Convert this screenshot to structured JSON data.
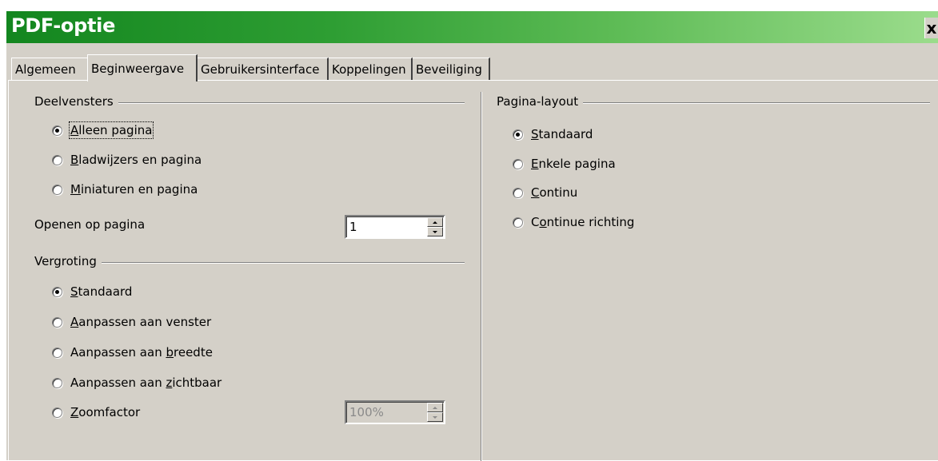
{
  "window": {
    "title": "PDF-optie",
    "close_glyph": "x"
  },
  "tabs": [
    "Algemeen",
    "Beginweergave",
    "Gebruikersinterface",
    "Koppelingen",
    "Beveiliging"
  ],
  "active_tab": "Beginweergave",
  "deelvensters": {
    "label": "Deelvensters",
    "options": [
      {
        "pre": "",
        "u": "A",
        "post": "lleen pagina",
        "selected": true
      },
      {
        "pre": "",
        "u": "B",
        "post": "ladwijzers en pagina",
        "selected": false
      },
      {
        "pre": "",
        "u": "M",
        "post": "iniaturen en pagina",
        "selected": false
      }
    ],
    "open_on_page_label": "Openen op pagina",
    "open_on_page_value": "1"
  },
  "vergroting": {
    "label": "Vergroting",
    "options": [
      {
        "pre": "",
        "u": "S",
        "post": "tandaard",
        "selected": true
      },
      {
        "pre": "",
        "u": "A",
        "post": "anpassen aan venster",
        "selected": false
      },
      {
        "pre": "Aanpassen aan ",
        "u": "b",
        "post": "reedte",
        "selected": false
      },
      {
        "pre": "Aanpassen aan ",
        "u": "z",
        "post": "ichtbaar",
        "selected": false
      },
      {
        "pre": "",
        "u": "Z",
        "post": "oomfactor",
        "selected": false
      }
    ],
    "zoom_value": "100%"
  },
  "pagina_layout": {
    "label": "Pagina-layout",
    "options": [
      {
        "pre": "",
        "u": "S",
        "post": "tandaard",
        "selected": true
      },
      {
        "pre": "",
        "u": "E",
        "post": "nkele pagina",
        "selected": false
      },
      {
        "pre": "",
        "u": "C",
        "post": "ontinu",
        "selected": false
      },
      {
        "pre": "C",
        "u": "o",
        "post": "ntinue richting",
        "selected": false
      }
    ]
  }
}
